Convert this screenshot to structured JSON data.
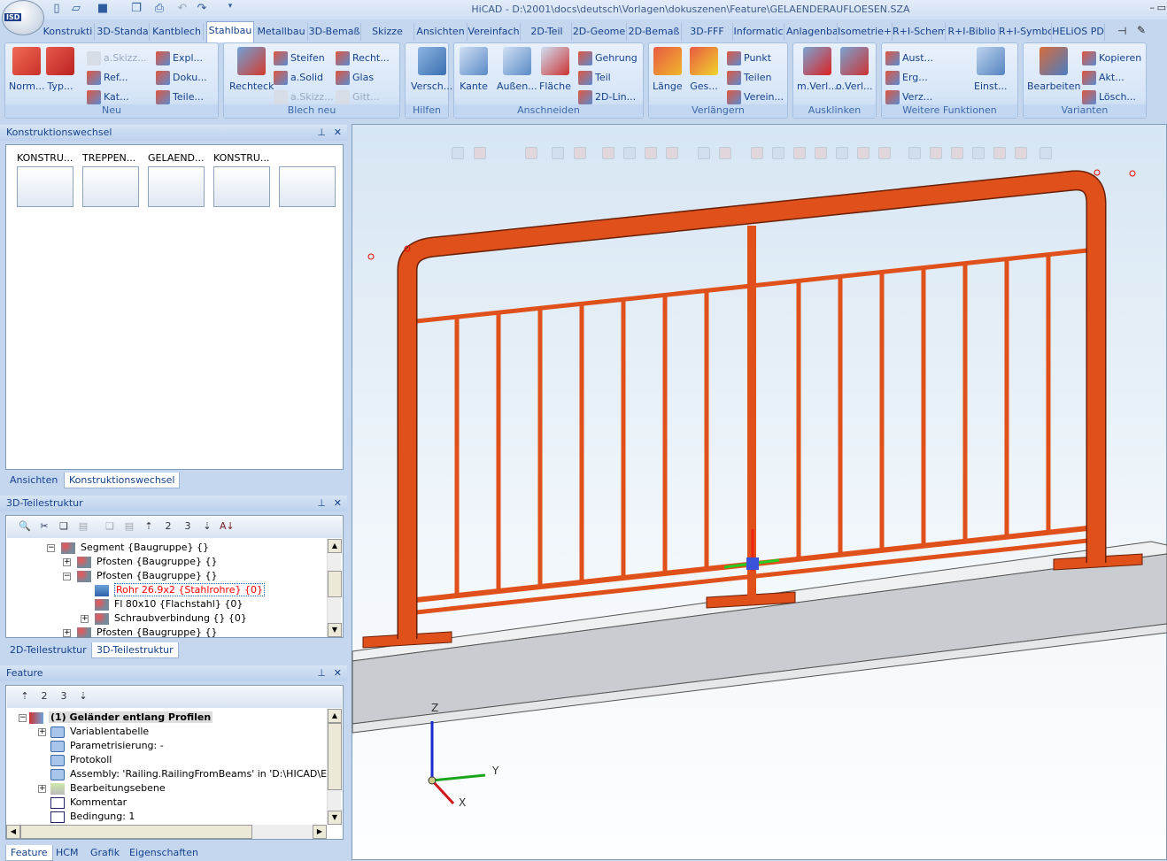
{
  "window": {
    "title": "HiCAD - D:\\2001\\docs\\deutsch\\Vorlagen\\dokuszenen\\Feature\\GELAENDERAUFLOESEN.SZA",
    "logo_text": "ISD"
  },
  "ribbon_tabs": [
    "Konstrukti",
    "3D-Standa",
    "Kantblech",
    "Stahlbau",
    "Metallbau",
    "3D-Bemaß",
    "Skizze",
    "Ansichten",
    "Vereinfach",
    "2D-Teil",
    "2D-Geome",
    "2D-Bemaß",
    "3D-FFF",
    "Informatic",
    "Anlagenba",
    "Isometrie+",
    "R+I-Schem",
    "R+I-Biblio",
    "R+I-Symbo",
    "HELiOS PD"
  ],
  "active_tab": "Stahlbau",
  "groups": {
    "neu": {
      "label": "Neu",
      "big": [
        "Norm...",
        "Typ..."
      ],
      "small": [
        "a.Skizz...",
        "Ref...",
        "Kat...",
        "Expl...",
        "Doku...",
        "Teile..."
      ]
    },
    "blech": {
      "label": "Blech neu",
      "big": [
        "Rechteck"
      ],
      "small": [
        "Steifen",
        "a.Solid",
        "a.Skizz...",
        "Recht...",
        "Glas",
        "Gitt..."
      ]
    },
    "hilfen": {
      "label": "Hilfen",
      "big": [
        "Versch..."
      ]
    },
    "anschneiden": {
      "label": "Anschneiden",
      "big": [
        "Kante",
        "Außen...",
        "Fläche"
      ],
      "small": [
        "Gehrung",
        "Teil",
        "2D-Lin..."
      ]
    },
    "verlaengern": {
      "label": "Verlängern",
      "big": [
        "Länge",
        "Ges..."
      ],
      "small": [
        "Punkt",
        "Teilen",
        "Verein..."
      ]
    },
    "ausklinken": {
      "label": "Ausklinken",
      "big": [
        "m.Verl...",
        "o.Verl..."
      ]
    },
    "weitere": {
      "label": "Weitere Funktionen",
      "big": [
        "Einst..."
      ],
      "small": [
        "Aust...",
        "Erg...",
        "Verz..."
      ]
    },
    "varianten": {
      "label": "Varianten",
      "big": [
        "Bearbeiten"
      ],
      "small": [
        "Kopieren",
        "Akt...",
        "Lösch..."
      ]
    }
  },
  "konstruktionswechsel": {
    "title": "Konstruktionswechsel",
    "thumbs": [
      "KONSTRU...",
      "TREPPEN...",
      "GELAEND...",
      "KONSTRU...",
      ""
    ],
    "tabs": [
      "Ansichten",
      "Konstruktionswechsel"
    ]
  },
  "teilestruktur": {
    "title": "3D-Teilestruktur",
    "tree": [
      "Segment {Baugruppe} {}",
      "Pfosten {Baugruppe} {}",
      "Pfosten {Baugruppe} {}",
      "Rohr 26.9x2 {Stahlrohre} {0}",
      "Fl 80x10 {Flachstahl} {0}",
      "Schraubverbindung {} {0}",
      "Pfosten {Baugruppe} {}"
    ],
    "tabs": [
      "2D-Teilestruktur",
      "3D-Teilestruktur"
    ],
    "toolbar_labels": [
      "2",
      "3"
    ]
  },
  "feature": {
    "title": "Feature",
    "root": "(1) Geländer entlang Profilen",
    "tree": [
      "Variablentabelle",
      "Parametrisierung: -",
      "Protokoll",
      "Assembly: 'Railing.RailingFromBeams' in 'D:\\HICAD\\EXE\\MOD",
      "Bearbeitungsebene",
      "Kommentar",
      "Bedingung: 1"
    ],
    "tabs": [
      "Feature",
      "HCM",
      "Grafik",
      "Eigenschaften"
    ],
    "toolbar_labels": [
      "2",
      "3"
    ]
  },
  "axes": {
    "x": "X",
    "y": "Y",
    "z": "Z"
  },
  "colors": {
    "railing": "#e0501a",
    "accent": "#15428b",
    "selected_text": "#ff0000"
  }
}
